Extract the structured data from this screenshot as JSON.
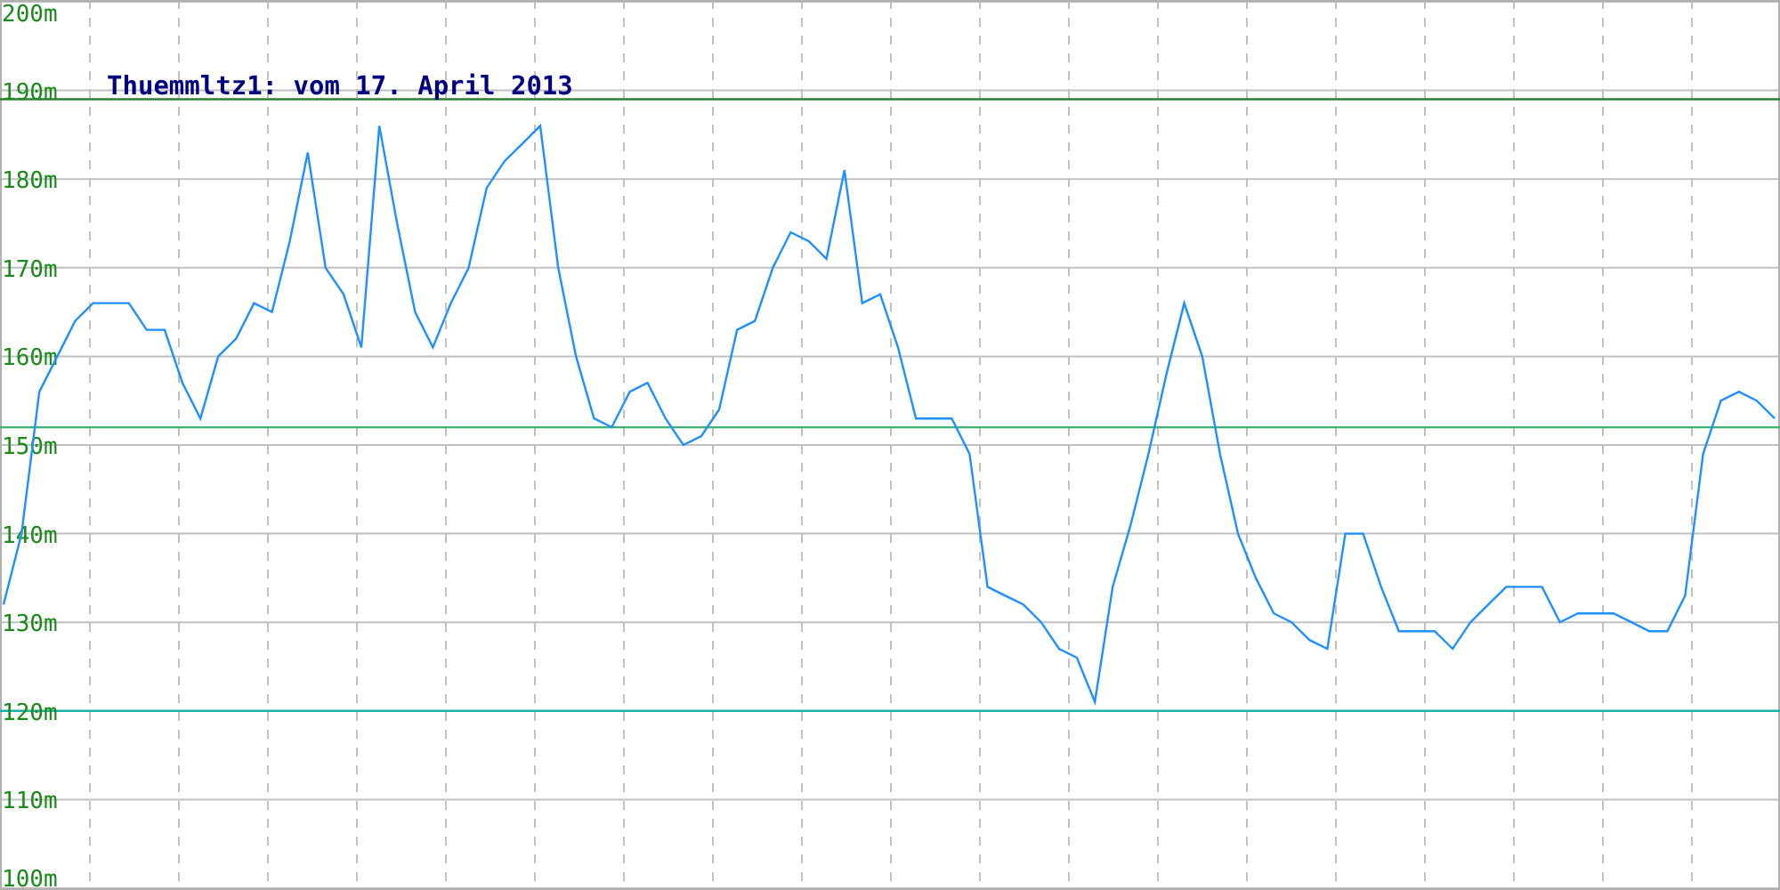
{
  "chart": {
    "chart_data": {
      "type": "line",
      "title": "Thuemmltz1: vom 17. April 2013",
      "ylim": [
        100,
        200
      ],
      "yticks": [
        {
          "value": 100,
          "label": "100m"
        },
        {
          "value": 110,
          "label": "110m"
        },
        {
          "value": 120,
          "label": "120m"
        },
        {
          "value": 130,
          "label": "130m"
        },
        {
          "value": 140,
          "label": "140m"
        },
        {
          "value": 150,
          "label": "150m"
        },
        {
          "value": 160,
          "label": "160m"
        },
        {
          "value": 170,
          "label": "170m"
        },
        {
          "value": 180,
          "label": "180m"
        },
        {
          "value": 190,
          "label": "190m"
        },
        {
          "value": 200,
          "label": "200m"
        }
      ],
      "grid": true,
      "series": [
        {
          "color": "#1e90ff",
          "values": [
            132,
            140,
            156,
            160,
            164,
            166,
            166,
            166,
            163,
            163,
            157,
            153,
            160,
            162,
            166,
            165,
            173,
            183,
            170,
            167,
            161,
            186,
            175,
            165,
            161,
            166,
            170,
            179,
            182,
            184,
            186,
            170,
            160,
            153,
            152,
            156,
            157,
            153,
            150,
            151,
            154,
            163,
            164,
            170,
            174,
            173,
            171,
            181,
            166,
            167,
            161,
            153,
            153,
            153,
            149,
            134,
            133,
            132,
            130,
            127,
            126,
            121,
            134,
            141,
            149,
            158,
            166,
            160,
            149,
            140,
            135,
            131,
            130,
            128,
            127,
            140,
            140,
            134,
            129,
            129,
            129,
            127,
            130,
            132,
            134,
            134,
            134,
            130,
            131,
            131,
            131,
            130,
            129,
            129,
            133,
            149,
            155,
            156,
            155,
            153
          ]
        }
      ],
      "ref_lines": [
        {
          "axis": "y",
          "value": 189,
          "color": "#2e7d32"
        },
        {
          "axis": "y",
          "value": 152,
          "color": "#3cb371"
        },
        {
          "axis": "y",
          "value": 120,
          "color": "#20b2aa"
        }
      ]
    }
  }
}
